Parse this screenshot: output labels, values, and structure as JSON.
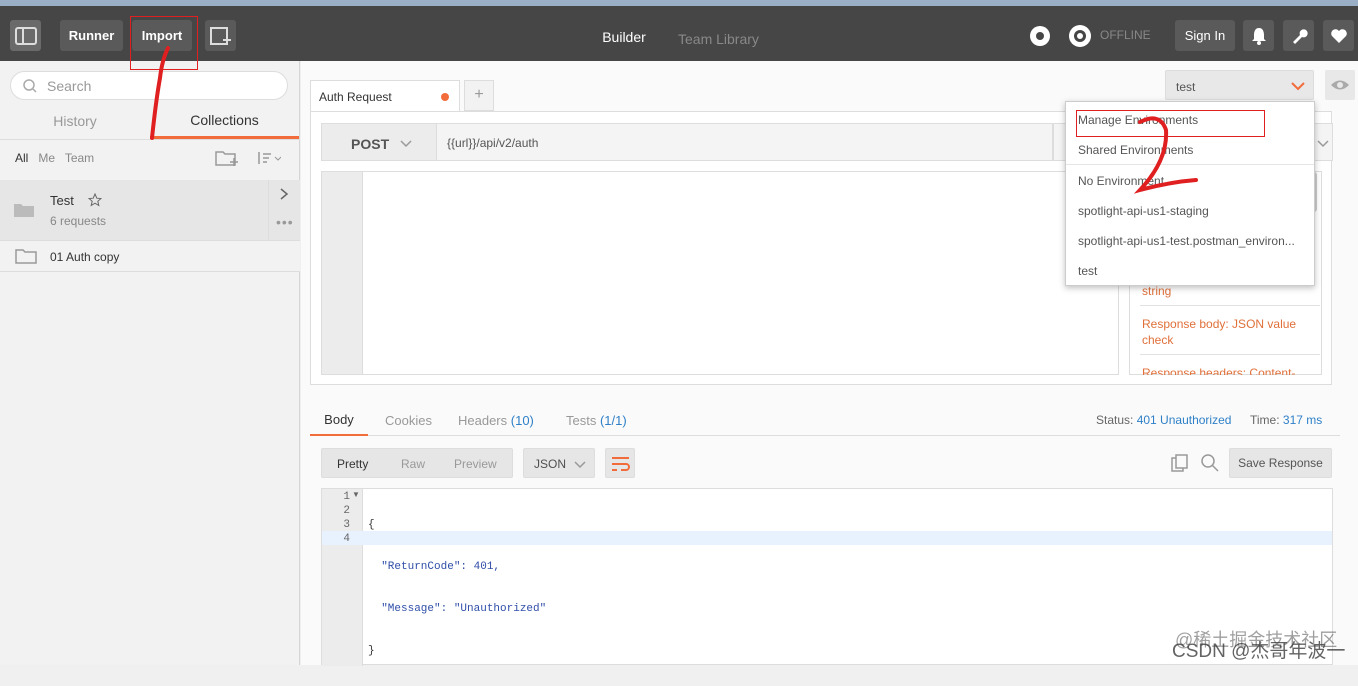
{
  "topbar": {
    "runner_label": "Runner",
    "import_label": "Import",
    "tab_builder": "Builder",
    "tab_team_library": "Team Library",
    "offline_label": "OFFLINE",
    "signin_label": "Sign In"
  },
  "sidebar": {
    "search_placeholder": "Search",
    "tab_history": "History",
    "tab_collections": "Collections",
    "filter_all": "All",
    "filter_me": "Me",
    "filter_team": "Team",
    "collections": [
      {
        "name": "Test",
        "sub": "6 requests"
      },
      {
        "name": "01 Auth copy",
        "sub": ""
      }
    ]
  },
  "request": {
    "tab_name": "Auth Request",
    "method": "POST",
    "url": "{{url}}/api/v2/auth",
    "environment": "test"
  },
  "env_menu": {
    "items": [
      "Manage Environments",
      "Shared Environments",
      "No Environment",
      "spotlight-api-us1-staging",
      "spotlight-api-us1-test.postman_environ...",
      "test"
    ]
  },
  "snippets": {
    "item1": "string",
    "item2": "Response body: JSON value check",
    "item3": "Response headers: Content-"
  },
  "response": {
    "tab_body": "Body",
    "tab_cookies": "Cookies",
    "tab_headers": "Headers",
    "headers_count": "(10)",
    "tab_tests": "Tests",
    "tests_count": "(1/1)",
    "status_label": "Status:",
    "status_value": "401 Unauthorized",
    "time_label": "Time:",
    "time_value": "317 ms",
    "view_pretty": "Pretty",
    "view_raw": "Raw",
    "view_preview": "Preview",
    "format": "JSON",
    "save_label": "Save Response",
    "lines": [
      "1",
      "2",
      "3",
      "4"
    ],
    "code": [
      "{",
      "  \"ReturnCode\": 401,",
      "  \"Message\": \"Unauthorized\"",
      "}"
    ]
  },
  "annotations": {
    "mark1": "1",
    "mark2": "2"
  },
  "watermark": "CSDN @杰哥年波一",
  "watermark2": "@稀土掘金技术社区",
  "colors": {
    "accent": "#f26b3a",
    "link": "#2f80c8",
    "topbar": "#464646"
  }
}
